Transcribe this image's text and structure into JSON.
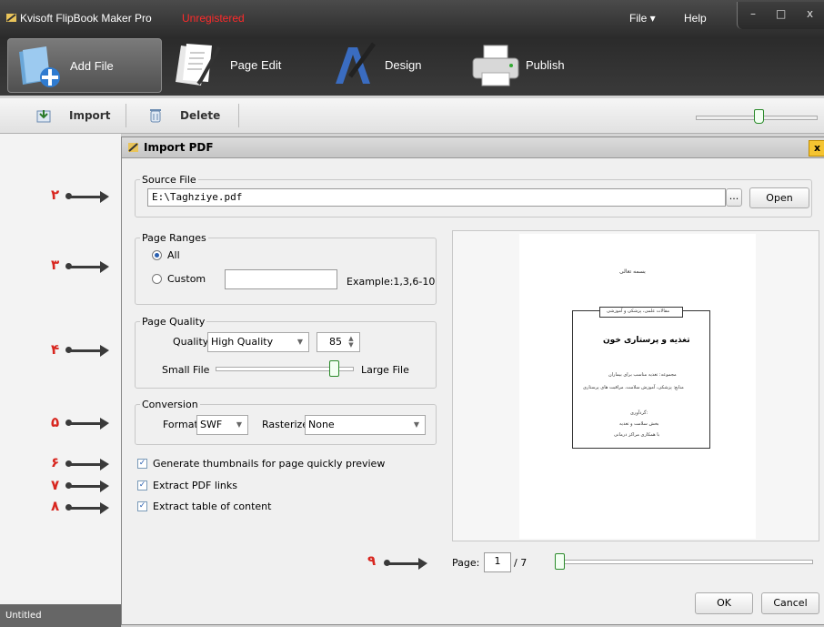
{
  "app": {
    "title": "Kvisoft FlipBook Maker Pro",
    "status": "Unregistered"
  },
  "menu": {
    "file": "File ▾",
    "help": "Help"
  },
  "window_buttons": {
    "minimize": "–",
    "maximize": "□",
    "close": "x"
  },
  "tabs": [
    {
      "label": "Add File",
      "icon": "add-file-icon"
    },
    {
      "label": "Page Edit",
      "icon": "page-edit-icon"
    },
    {
      "label": "Design",
      "icon": "design-icon"
    },
    {
      "label": "Publish",
      "icon": "printer-icon"
    }
  ],
  "toolbar": {
    "import": "Import",
    "delete": "Delete",
    "zoom_level": 0.52
  },
  "status": {
    "project": "Untitled"
  },
  "dialog": {
    "title": "Import PDF",
    "close": "x",
    "source": {
      "legend": "Source File",
      "path": "E:\\Taghziye.pdf",
      "browse": "...",
      "open": "Open"
    },
    "ranges": {
      "legend": "Page Ranges",
      "all": "All",
      "custom": "Custom",
      "custom_value": "",
      "example": "Example:1,3,6-10",
      "selected": "All"
    },
    "quality": {
      "legend": "Page Quality",
      "label": "Quality",
      "value": "High Quality",
      "number": "85",
      "small": "Small File",
      "large": "Large File",
      "slider": 0.85
    },
    "conversion": {
      "legend": "Conversion",
      "format_label": "Format",
      "format": "SWF",
      "rasterize_label": "Rasterize",
      "rasterize": "None"
    },
    "options": [
      {
        "label": "Generate thumbnails for page quickly preview",
        "checked": true
      },
      {
        "label": "Extract PDF links",
        "checked": true
      },
      {
        "label": "Extract table of content",
        "checked": true
      }
    ],
    "preview": {
      "page_label": "Page:",
      "page": "1",
      "total": "/ 7",
      "slider": 0.0,
      "doc_lines": {
        "top": "بسمه تعالی",
        "badge": "مقالات علمی، پزشکی و آموزشی",
        "headline": "تغذیه و پرستاری خون",
        "line1": "مجموعه: تغذیه مناسب برای بیماران",
        "line2": "منابع: پزشکی، آموزش سلامت، مراقبت های پرستاری",
        "line3": "گردآوری:",
        "line4": "بخش سلامت و تغذیه",
        "line5": "با همکاری مراکز درمانی"
      }
    },
    "ok": "OK",
    "cancel": "Cancel"
  },
  "annotations": [
    "۲",
    "۳",
    "۴",
    "۵",
    "۶",
    "۷",
    "۸",
    "۹"
  ]
}
